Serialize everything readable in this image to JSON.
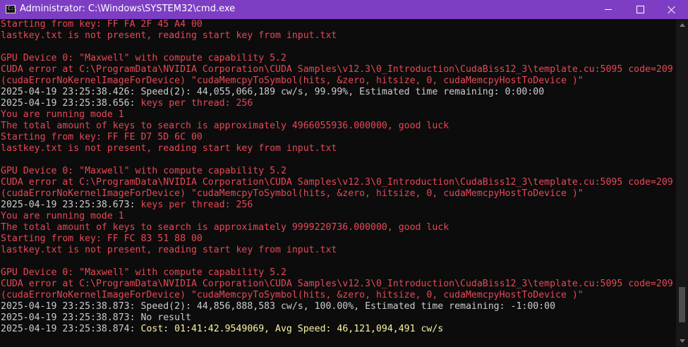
{
  "window": {
    "title": "Administrator: C:\\Windows\\SYSTEM32\\cmd.exe",
    "icon_text": "C:\\",
    "icon": "cmd-icon"
  },
  "colors": {
    "red": "#e74856",
    "white": "#cccccc",
    "yellow": "#f9f1a5"
  },
  "console": {
    "lines": [
      [
        {
          "t": "Starting from key: FF FA 2F 45 A4 00",
          "c": "red"
        }
      ],
      [
        {
          "t": "lastkey.txt is not present, reading start key from input.txt",
          "c": "red"
        }
      ],
      [
        {
          "t": " ",
          "c": "white"
        }
      ],
      [
        {
          "t": "GPU Device 0: \"Maxwell\" with compute capability 5.2",
          "c": "red"
        }
      ],
      [
        {
          "t": "CUDA error at C:\\ProgramData\\NVIDIA Corporation\\CUDA Samples\\v12.3\\0_Introduction\\CudaBiss12_3\\template.cu:5095 code=209",
          "c": "red"
        }
      ],
      [
        {
          "t": "(cudaErrorNoKernelImageForDevice) \"cudaMemcpyToSymbol(hits, &zero, hitsize, 0, cudaMemcpyHostToDevice )\"",
          "c": "red"
        }
      ],
      [
        {
          "t": "2025-04-19 23:25:38.426: Speed(2): 44,055,066,189 cw/s, 99.99%, Estimated time remaining: 0:00:00",
          "c": "white"
        }
      ],
      [
        {
          "t": "2025-04-19 23:25:38.656: ",
          "c": "white"
        },
        {
          "t": "keys per thread: 256",
          "c": "red"
        }
      ],
      [
        {
          "t": "You are running mode 1",
          "c": "red"
        }
      ],
      [
        {
          "t": "The total amount of keys to search is approximately 4966055936.000000, good luck",
          "c": "red"
        }
      ],
      [
        {
          "t": "Starting from key: FF FE D7 5D 6C 00",
          "c": "red"
        }
      ],
      [
        {
          "t": "lastkey.txt is not present, reading start key from input.txt",
          "c": "red"
        }
      ],
      [
        {
          "t": " ",
          "c": "white"
        }
      ],
      [
        {
          "t": "GPU Device 0: \"Maxwell\" with compute capability 5.2",
          "c": "red"
        }
      ],
      [
        {
          "t": "CUDA error at C:\\ProgramData\\NVIDIA Corporation\\CUDA Samples\\v12.3\\0_Introduction\\CudaBiss12_3\\template.cu:5095 code=209",
          "c": "red"
        }
      ],
      [
        {
          "t": "(cudaErrorNoKernelImageForDevice) \"cudaMemcpyToSymbol(hits, &zero, hitsize, 0, cudaMemcpyHostToDevice )\"",
          "c": "red"
        }
      ],
      [
        {
          "t": "2025-04-19 23:25:38.673: ",
          "c": "white"
        },
        {
          "t": "keys per thread: 256",
          "c": "red"
        }
      ],
      [
        {
          "t": "You are running mode 1",
          "c": "red"
        }
      ],
      [
        {
          "t": "The total amount of keys to search is approximately 9999220736.000000, good luck",
          "c": "red"
        }
      ],
      [
        {
          "t": "Starting from key: FF FC 83 51 88 00",
          "c": "red"
        }
      ],
      [
        {
          "t": "lastkey.txt is not present, reading start key from input.txt",
          "c": "red"
        }
      ],
      [
        {
          "t": " ",
          "c": "white"
        }
      ],
      [
        {
          "t": "GPU Device 0: \"Maxwell\" with compute capability 5.2",
          "c": "red"
        }
      ],
      [
        {
          "t": "CUDA error at C:\\ProgramData\\NVIDIA Corporation\\CUDA Samples\\v12.3\\0_Introduction\\CudaBiss12_3\\template.cu:5095 code=209",
          "c": "red"
        }
      ],
      [
        {
          "t": "(cudaErrorNoKernelImageForDevice) \"cudaMemcpyToSymbol(hits, &zero, hitsize, 0, cudaMemcpyHostToDevice )\"",
          "c": "red"
        }
      ],
      [
        {
          "t": "2025-04-19 23:25:38.873: Speed(2): 44,856,888,583 cw/s, 100.00%, Estimated time remaining: -1:00:00",
          "c": "white"
        }
      ],
      [
        {
          "t": "2025-04-19 23:25:38.873: No result",
          "c": "white"
        }
      ],
      [
        {
          "t": "2025-04-19 23:25:38.874: ",
          "c": "white"
        },
        {
          "t": "Cost: 01:41:42.9549069, Avg Speed: 46,121,094,491 cw/s",
          "c": "yellow"
        }
      ]
    ]
  }
}
